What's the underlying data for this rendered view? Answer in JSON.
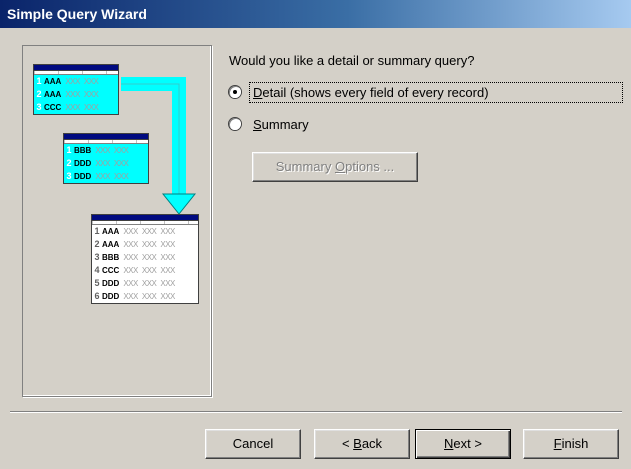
{
  "window": {
    "title": "Simple Query Wizard"
  },
  "question": "Would you like a detail or summary query?",
  "options": [
    {
      "label_pre": "",
      "label_key": "D",
      "label_post": "etail (shows every field of every record)",
      "selected": true
    },
    {
      "label_pre": "",
      "label_key": "S",
      "label_post": "ummary",
      "selected": false
    }
  ],
  "summary_options_button": {
    "label_pre": "Summary ",
    "label_key": "O",
    "label_post": "ptions ...",
    "enabled": false
  },
  "buttons": {
    "cancel": {
      "pre": "Cancel",
      "key": "",
      "post": ""
    },
    "back": {
      "pre": "< ",
      "key": "B",
      "post": "ack"
    },
    "next": {
      "pre": "",
      "key": "N",
      "post": "ext >"
    },
    "finish": {
      "pre": "",
      "key": "F",
      "post": "inish"
    }
  },
  "illustration": {
    "table1": [
      {
        "n": "1",
        "k": "AAA",
        "x": [
          "XXX",
          "XXX"
        ]
      },
      {
        "n": "2",
        "k": "AAA",
        "x": [
          "XXX",
          "XXX"
        ]
      },
      {
        "n": "3",
        "k": "CCC",
        "x": [
          "XXX",
          "XXX"
        ]
      }
    ],
    "table2": [
      {
        "n": "1",
        "k": "BBB",
        "x": [
          "XXX",
          "XXX"
        ]
      },
      {
        "n": "2",
        "k": "DDD",
        "x": [
          "XXX",
          "XXX"
        ]
      },
      {
        "n": "3",
        "k": "DDD",
        "x": [
          "XXX",
          "XXX"
        ]
      }
    ],
    "result": [
      {
        "n": "1",
        "k": "AAA",
        "x": [
          "XXX",
          "XXX",
          "XXX"
        ]
      },
      {
        "n": "2",
        "k": "AAA",
        "x": [
          "XXX",
          "XXX",
          "XXX"
        ]
      },
      {
        "n": "3",
        "k": "BBB",
        "x": [
          "XXX",
          "XXX",
          "XXX"
        ]
      },
      {
        "n": "4",
        "k": "CCC",
        "x": [
          "XXX",
          "XXX",
          "XXX"
        ]
      },
      {
        "n": "5",
        "k": "DDD",
        "x": [
          "XXX",
          "XXX",
          "XXX"
        ]
      },
      {
        "n": "6",
        "k": "DDD",
        "x": [
          "XXX",
          "XXX",
          "XXX"
        ]
      }
    ]
  },
  "colors": {
    "titlebar_start": "#0a246a",
    "titlebar_end": "#a6caf0",
    "face": "#d4d0c8",
    "highlight": "#00ffff"
  }
}
